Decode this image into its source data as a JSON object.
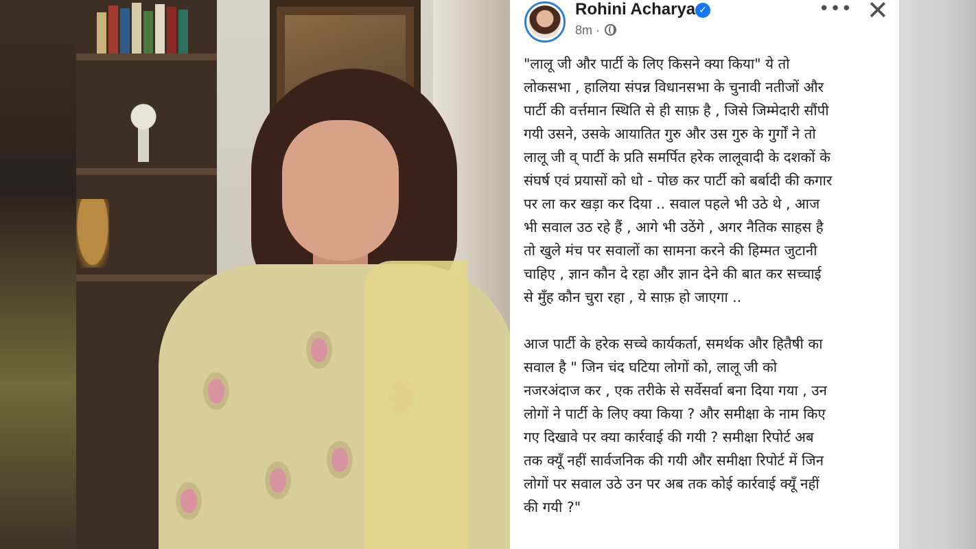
{
  "post": {
    "author": "Rohini Acharya",
    "time": "8m",
    "dot": "·",
    "paragraphs": [
      "\"लालू जी और पार्टी के लिए किसने क्या किया\" ये तो\nलोकसभा , हालिया संपन्न विधानसभा के चुनावी नतीजों और\nपार्टी की वर्त्तमान स्थिति से ही साफ़ है , जिसे जिम्मेदारी सौंपी\nगयी उसने, उसके आयातित गुरु और उस गुरु के गुर्गों ने तो\nलालू जी व् पार्टी के प्रति समर्पित हरेक लालूवादी के दशकों के\nसंघर्ष एवं प्रयासों को धो - पोछ कर पार्टी को बर्बादी की कगार\nपर ला कर खड़ा कर दिया .. सवाल पहले भी उठे थे , आज\nभी सवाल उठ रहे हैं , आगे भी उठेंगे , अगर नैतिक साहस है\nतो खुले मंच पर सवालों का सामना करने की हिम्मत जुटानी\nचाहिए , ज्ञान कौन दे रहा और ज्ञान देने की बात कर सच्चाई\nसे मुँह कौन चुरा रहा , ये साफ़ हो जाएगा ..",
      "आज पार्टी के हरेक सच्चे कार्यकर्ता, समर्थक और हितैषी का\nसवाल है \" जिन चंद घटिया लोगों को, लालू जी को\nनजरअंदाज कर , एक तरीके से सर्वेसर्वा बना दिया गया , उन\nलोगों ने पार्टी के लिए क्या किया ? और समीक्षा के नाम किए\nगए दिखावे पर क्या कार्रवाई की गयी ? समीक्षा रिपोर्ट अब\nतक क्यूँ नहीं सार्वजनिक की गयी और समीक्षा रिपोर्ट में जिन\nलोगों पर सवाल उठे उन पर अब तक कोई कार्रवाई क्यूँ नहीं\nकी गयी ?\""
    ]
  },
  "icons": {
    "verified": "verified-badge-icon",
    "globe": "globe-icon",
    "more": "more-options-icon",
    "close": "close-icon"
  },
  "colors": {
    "verified": "#1877f2",
    "text": "#1c1e21",
    "meta": "#65676b"
  }
}
